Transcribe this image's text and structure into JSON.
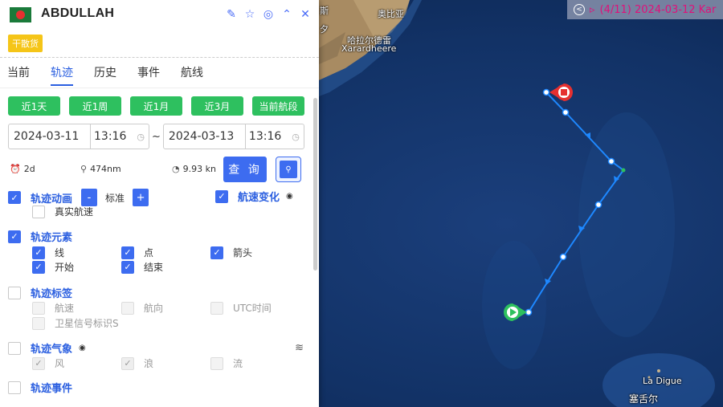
{
  "ship": {
    "name": "ABDULLAH",
    "type_tag": "干散货",
    "flag_colors": {
      "field": "#1a7a3a",
      "disc": "#e53030"
    }
  },
  "header_icons": [
    "edit-icon",
    "star-icon",
    "locate-icon",
    "collapse-icon",
    "close-icon"
  ],
  "tabs": [
    {
      "label": "当前",
      "active": false
    },
    {
      "label": "轨迹",
      "active": true
    },
    {
      "label": "历史",
      "active": false
    },
    {
      "label": "事件",
      "active": false
    },
    {
      "label": "航线",
      "active": false
    }
  ],
  "range_buttons": [
    "近1天",
    "近1周",
    "近1月",
    "近3月",
    "当前航段"
  ],
  "date_range": {
    "start_date": "2024-03-11",
    "start_time": "13:16",
    "end_date": "2024-03-13",
    "end_time": "13:16",
    "separator": "~"
  },
  "stats": {
    "duration": "2d",
    "distance": "474nm",
    "speed": "9.93 kn"
  },
  "query_label": "查 询",
  "sections": {
    "animation": {
      "label": "轨迹动画",
      "checked": true,
      "minus": "-",
      "plus": "+",
      "speed_label": "标准",
      "real_speed": "真实航速"
    },
    "speed_change": {
      "label": "航速变化",
      "checked": true
    },
    "elements": {
      "label": "轨迹元素",
      "checked": true,
      "items": [
        {
          "label": "线",
          "checked": true
        },
        {
          "label": "点",
          "checked": true
        },
        {
          "label": "箭头",
          "checked": true
        },
        {
          "label": "开始",
          "checked": true
        },
        {
          "label": "结束",
          "checked": true
        }
      ]
    },
    "labels": {
      "label": "轨迹标签",
      "checked": false,
      "items": [
        "航速",
        "航向",
        "UTC时间",
        "卫星信号标识S"
      ]
    },
    "weather": {
      "label": "轨迹气象",
      "checked": false,
      "items": [
        {
          "label": "风",
          "checked": true
        },
        {
          "label": "浪",
          "checked": true
        },
        {
          "label": "流",
          "checked": false
        }
      ]
    },
    "events": {
      "label": "轨迹事件",
      "checked": false
    }
  },
  "banner": {
    "text": "(4/11) 2024-03-12 Kar",
    "color": "#e0107a"
  },
  "map_labels": {
    "top1": "奥比亚",
    "top2": "哈拉尔德雷",
    "top3": "Xarardheere",
    "la_digue": "La Digue",
    "seychelles": "塞舌尔",
    "frag1": "斯",
    "frag2": "夕"
  },
  "colors": {
    "accent": "#3d6cf0",
    "green": "#2ec05f",
    "track": "#1e88ff",
    "end_marker": "#e53030",
    "start_marker": "#2ec05f"
  }
}
